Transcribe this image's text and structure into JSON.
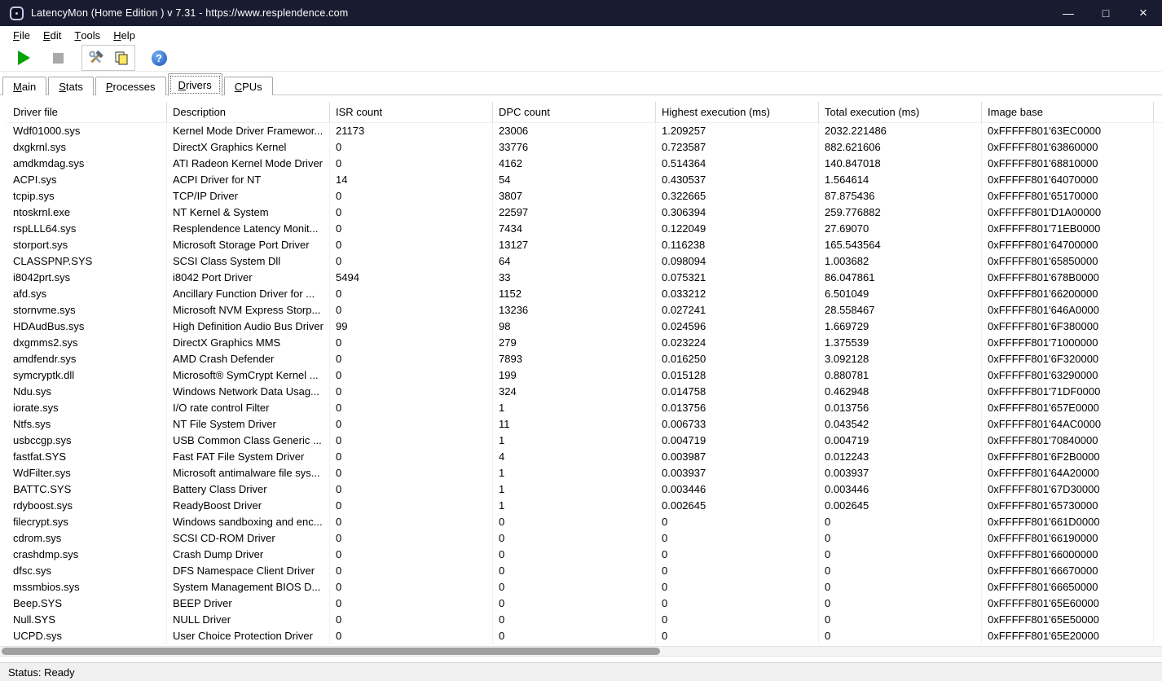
{
  "window": {
    "title": "LatencyMon  (Home Edition )  v 7.31 - https://www.resplendence.com",
    "controls": {
      "minimize": "—",
      "maximize": "□",
      "close": "×"
    }
  },
  "menu": {
    "items": [
      {
        "label": "File"
      },
      {
        "label": "Edit"
      },
      {
        "label": "Tools"
      },
      {
        "label": "Help"
      }
    ]
  },
  "toolbar": {
    "icons": [
      "play-icon",
      "stop-icon",
      "tools-icon",
      "copy-icon",
      "help-icon"
    ],
    "help_glyph": "?"
  },
  "tabs": [
    {
      "label": "Main",
      "selected": false
    },
    {
      "label": "Stats",
      "selected": false
    },
    {
      "label": "Processes",
      "selected": false
    },
    {
      "label": "Drivers",
      "selected": true
    },
    {
      "label": "CPUs",
      "selected": false
    }
  ],
  "table": {
    "columns": [
      "Driver file",
      "Description",
      "ISR count",
      "DPC count",
      "Highest execution (ms)",
      "Total execution (ms)",
      "Image base"
    ],
    "column_keys": [
      "driver-file",
      "description",
      "isr-count",
      "dpc-count",
      "highest-execution-ms",
      "total-execution-ms",
      "image-base"
    ],
    "rows": [
      [
        "Wdf01000.sys",
        "Kernel Mode Driver Framewor...",
        "21173",
        "23006",
        "1.209257",
        "2032.221486",
        "0xFFFFF801'63EC0000"
      ],
      [
        "dxgkrnl.sys",
        "DirectX Graphics Kernel",
        "0",
        "33776",
        "0.723587",
        "882.621606",
        "0xFFFFF801'63860000"
      ],
      [
        "amdkmdag.sys",
        "ATI Radeon Kernel Mode Driver",
        "0",
        "4162",
        "0.514364",
        "140.847018",
        "0xFFFFF801'68810000"
      ],
      [
        "ACPI.sys",
        "ACPI Driver for NT",
        "14",
        "54",
        "0.430537",
        "1.564614",
        "0xFFFFF801'64070000"
      ],
      [
        "tcpip.sys",
        "TCP/IP Driver",
        "0",
        "3807",
        "0.322665",
        "87.875436",
        "0xFFFFF801'65170000"
      ],
      [
        "ntoskrnl.exe",
        "NT Kernel & System",
        "0",
        "22597",
        "0.306394",
        "259.776882",
        "0xFFFFF801'D1A00000"
      ],
      [
        "rspLLL64.sys",
        "Resplendence Latency Monit...",
        "0",
        "7434",
        "0.122049",
        "27.69070",
        "0xFFFFF801'71EB0000"
      ],
      [
        "storport.sys",
        "Microsoft Storage Port Driver",
        "0",
        "13127",
        "0.116238",
        "165.543564",
        "0xFFFFF801'64700000"
      ],
      [
        "CLASSPNP.SYS",
        "SCSI Class System Dll",
        "0",
        "64",
        "0.098094",
        "1.003682",
        "0xFFFFF801'65850000"
      ],
      [
        "i8042prt.sys",
        "i8042 Port Driver",
        "5494",
        "33",
        "0.075321",
        "86.047861",
        "0xFFFFF801'678B0000"
      ],
      [
        "afd.sys",
        "Ancillary Function Driver for ...",
        "0",
        "1152",
        "0.033212",
        "6.501049",
        "0xFFFFF801'66200000"
      ],
      [
        "stornvme.sys",
        "Microsoft NVM Express Storp...",
        "0",
        "13236",
        "0.027241",
        "28.558467",
        "0xFFFFF801'646A0000"
      ],
      [
        "HDAudBus.sys",
        "High Definition Audio Bus Driver",
        "99",
        "98",
        "0.024596",
        "1.669729",
        "0xFFFFF801'6F380000"
      ],
      [
        "dxgmms2.sys",
        "DirectX Graphics MMS",
        "0",
        "279",
        "0.023224",
        "1.375539",
        "0xFFFFF801'71000000"
      ],
      [
        "amdfendr.sys",
        "AMD Crash Defender",
        "0",
        "7893",
        "0.016250",
        "3.092128",
        "0xFFFFF801'6F320000"
      ],
      [
        "symcryptk.dll",
        "Microsoft® SymCrypt Kernel ...",
        "0",
        "199",
        "0.015128",
        "0.880781",
        "0xFFFFF801'63290000"
      ],
      [
        "Ndu.sys",
        "Windows Network Data Usag...",
        "0",
        "324",
        "0.014758",
        "0.462948",
        "0xFFFFF801'71DF0000"
      ],
      [
        "iorate.sys",
        "I/O rate control Filter",
        "0",
        "1",
        "0.013756",
        "0.013756",
        "0xFFFFF801'657E0000"
      ],
      [
        "Ntfs.sys",
        "NT File System Driver",
        "0",
        "11",
        "0.006733",
        "0.043542",
        "0xFFFFF801'64AC0000"
      ],
      [
        "usbccgp.sys",
        "USB Common Class Generic ...",
        "0",
        "1",
        "0.004719",
        "0.004719",
        "0xFFFFF801'70840000"
      ],
      [
        "fastfat.SYS",
        "Fast FAT File System Driver",
        "0",
        "4",
        "0.003987",
        "0.012243",
        "0xFFFFF801'6F2B0000"
      ],
      [
        "WdFilter.sys",
        "Microsoft antimalware file sys...",
        "0",
        "1",
        "0.003937",
        "0.003937",
        "0xFFFFF801'64A20000"
      ],
      [
        "BATTC.SYS",
        "Battery Class Driver",
        "0",
        "1",
        "0.003446",
        "0.003446",
        "0xFFFFF801'67D30000"
      ],
      [
        "rdyboost.sys",
        "ReadyBoost Driver",
        "0",
        "1",
        "0.002645",
        "0.002645",
        "0xFFFFF801'65730000"
      ],
      [
        "filecrypt.sys",
        "Windows sandboxing and enc...",
        "0",
        "0",
        "0",
        "0",
        "0xFFFFF801'661D0000"
      ],
      [
        "cdrom.sys",
        "SCSI CD-ROM Driver",
        "0",
        "0",
        "0",
        "0",
        "0xFFFFF801'66190000"
      ],
      [
        "crashdmp.sys",
        "Crash Dump Driver",
        "0",
        "0",
        "0",
        "0",
        "0xFFFFF801'66000000"
      ],
      [
        "dfsc.sys",
        "DFS Namespace Client Driver",
        "0",
        "0",
        "0",
        "0",
        "0xFFFFF801'66670000"
      ],
      [
        "mssmbios.sys",
        "System Management BIOS D...",
        "0",
        "0",
        "0",
        "0",
        "0xFFFFF801'66650000"
      ],
      [
        "Beep.SYS",
        "BEEP Driver",
        "0",
        "0",
        "0",
        "0",
        "0xFFFFF801'65E60000"
      ],
      [
        "Null.SYS",
        "NULL Driver",
        "0",
        "0",
        "0",
        "0",
        "0xFFFFF801'65E50000"
      ],
      [
        "UCPD.sys",
        "User Choice Protection Driver",
        "0",
        "0",
        "0",
        "0",
        "0xFFFFF801'65E20000"
      ]
    ]
  },
  "status_bar": {
    "text": "Status: Ready"
  }
}
